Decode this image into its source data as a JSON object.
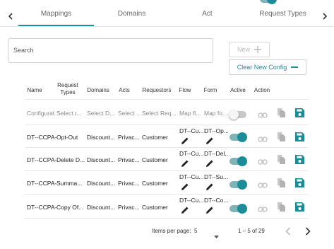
{
  "tabs": [
    {
      "label": "Mappings"
    },
    {
      "label": "Domains"
    },
    {
      "label": "Act"
    },
    {
      "label": "Request Types"
    }
  ],
  "search": {
    "placeholder": "Search"
  },
  "buttons": {
    "new_label": "New",
    "clear_label": "Clear New Config"
  },
  "headers": {
    "name": "Name",
    "request_types_1": "Request",
    "request_types_2": "Types",
    "domains": "Domains",
    "acts": "Acts",
    "requestors": "Requestors",
    "flow": "Flow",
    "form": "Form",
    "active": "Active",
    "action": "Action"
  },
  "new_row": {
    "name": "Configurat",
    "request_types": "Select r...",
    "domains": "Select D...",
    "acts": "Select ...",
    "requestors": "Select Req...",
    "flow": "Map fl...",
    "form": "Map fo..."
  },
  "rows": [
    {
      "name": "DT--CCPA-I",
      "request_types": "Opt-Out",
      "domains": "Discount...",
      "acts": "Privac...",
      "requestors": "Customer",
      "flow": "DT--Cu...",
      "form": "DT--Op..."
    },
    {
      "name": "DT--CCPA-I",
      "request_types": "Delete D...",
      "domains": "Discount...",
      "acts": "Privac...",
      "requestors": "Customer",
      "flow": "DT--Cu...",
      "form": "DT--Del..."
    },
    {
      "name": "DT--CCPA-I",
      "request_types": "Summa...",
      "domains": "Discount...",
      "acts": "Privac...",
      "requestors": "Customer",
      "flow": "DT--Cu...",
      "form": "DT--Su..."
    },
    {
      "name": "DT--CCPA-I",
      "request_types": "Copy Of...",
      "domains": "Discount...",
      "acts": "Privac...",
      "requestors": "Customer",
      "flow": "DT--Cu...",
      "form": "DT--Co..."
    }
  ],
  "pagination": {
    "items_per_page_label": "Items per page:",
    "items_per_page_value": "5",
    "range": "1 – 5 of 29"
  },
  "colors": {
    "accent": "#1b8d99",
    "toggle_track_on": "#7fb3b8",
    "icon_grey": "#bdbdbd"
  }
}
